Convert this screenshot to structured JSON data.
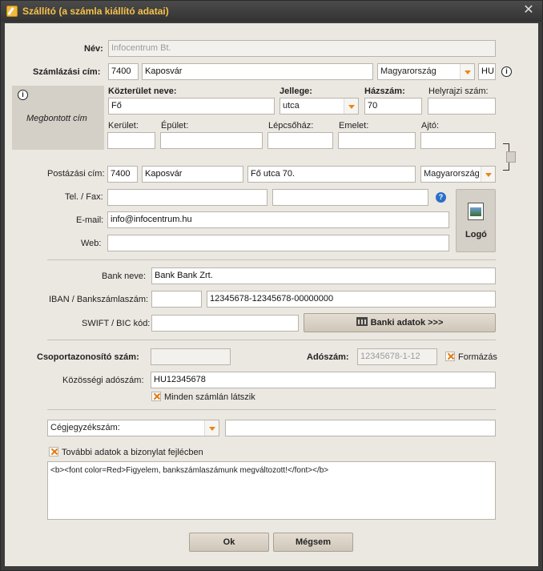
{
  "window": {
    "title": "Szállító (a számla kiállító adatai)"
  },
  "labels": {
    "nev": "Név:",
    "szamlazasi_cim": "Számlázási cím:",
    "megbontott_cim": "Megbontott cím",
    "kozterulet_neve": "Közterület neve:",
    "jellege": "Jellege:",
    "hazszam": "Házszám:",
    "helyrajzi_szam": "Helyrajzi szám:",
    "kerulet": "Kerület:",
    "epulet": "Épület:",
    "lepcsohaz": "Lépcsőház:",
    "emelet": "Emelet:",
    "ajto": "Ajtó:",
    "postazasi_cim": "Postázási cím:",
    "tel_fax": "Tel. / Fax:",
    "email": "E-mail:",
    "web": "Web:",
    "logo": "Logó",
    "bank_neve": "Bank neve:",
    "iban": "IBAN / Bankszámlaszám:",
    "swift": "SWIFT / BIC kód:",
    "csoportazonosito": "Csoportazonosító szám:",
    "adoszam": "Adószám:",
    "formazas": "Formázás",
    "kozossegi_adoszam": "Közösségi adószám:",
    "minden_szamlan": "Minden számlán látszik",
    "tovabbi_adatok": "További adatok a bizonylat fejlécben"
  },
  "fields": {
    "nev": "Infocentrum Bt.",
    "szamlazasi_irsz": "7400",
    "szamlazasi_varos": "Kaposvár",
    "szamlazasi_orszag": "Magyarország",
    "szamlazasi_orszagkod": "HU",
    "kozterulet_neve": "Fő",
    "jellege": "utca",
    "hazszam": "70",
    "helyrajzi_szam": "",
    "kerulet": "",
    "epulet": "",
    "lepcsohaz": "",
    "emelet": "",
    "ajto": "",
    "postazasi_irsz": "7400",
    "postazasi_varos": "Kaposvár",
    "postazasi_cim": "Fő utca 70.",
    "postazasi_orszag": "Magyarország",
    "tel": "",
    "fax": "",
    "email": "info@infocentrum.hu",
    "web": "",
    "bank_neve": "Bank Bank Zrt.",
    "iban_prefix": "",
    "bankszamlaszam": "12345678-12345678-00000000",
    "swift": "",
    "csoportazonosito": "",
    "adoszam": "12345678-1-12",
    "kozossegi_adoszam": "HU12345678",
    "cegjegyzek_select": "Cégjegyzékszám:",
    "cegjegyzek_value": "",
    "fejlec_html": "<b><font color=Red>Figyelem, bankszámlaszámunk megváltozott!</font></b>"
  },
  "buttons": {
    "banki_adatok": "Banki adatok >>>",
    "ok": "Ok",
    "megsem": "Mégsem"
  },
  "checkboxes": {
    "formazas": true,
    "minden_szamlan": true,
    "tovabbi_adatok": true
  },
  "colors": {
    "accent": "#e8861a",
    "title": "#f6c24a",
    "help": "#2b6fc8"
  },
  "icons": {
    "title": "edit-icon",
    "close": "close-icon",
    "info": "info-icon",
    "help": "help-icon",
    "bank": "bank-icon",
    "logo": "image-icon"
  }
}
